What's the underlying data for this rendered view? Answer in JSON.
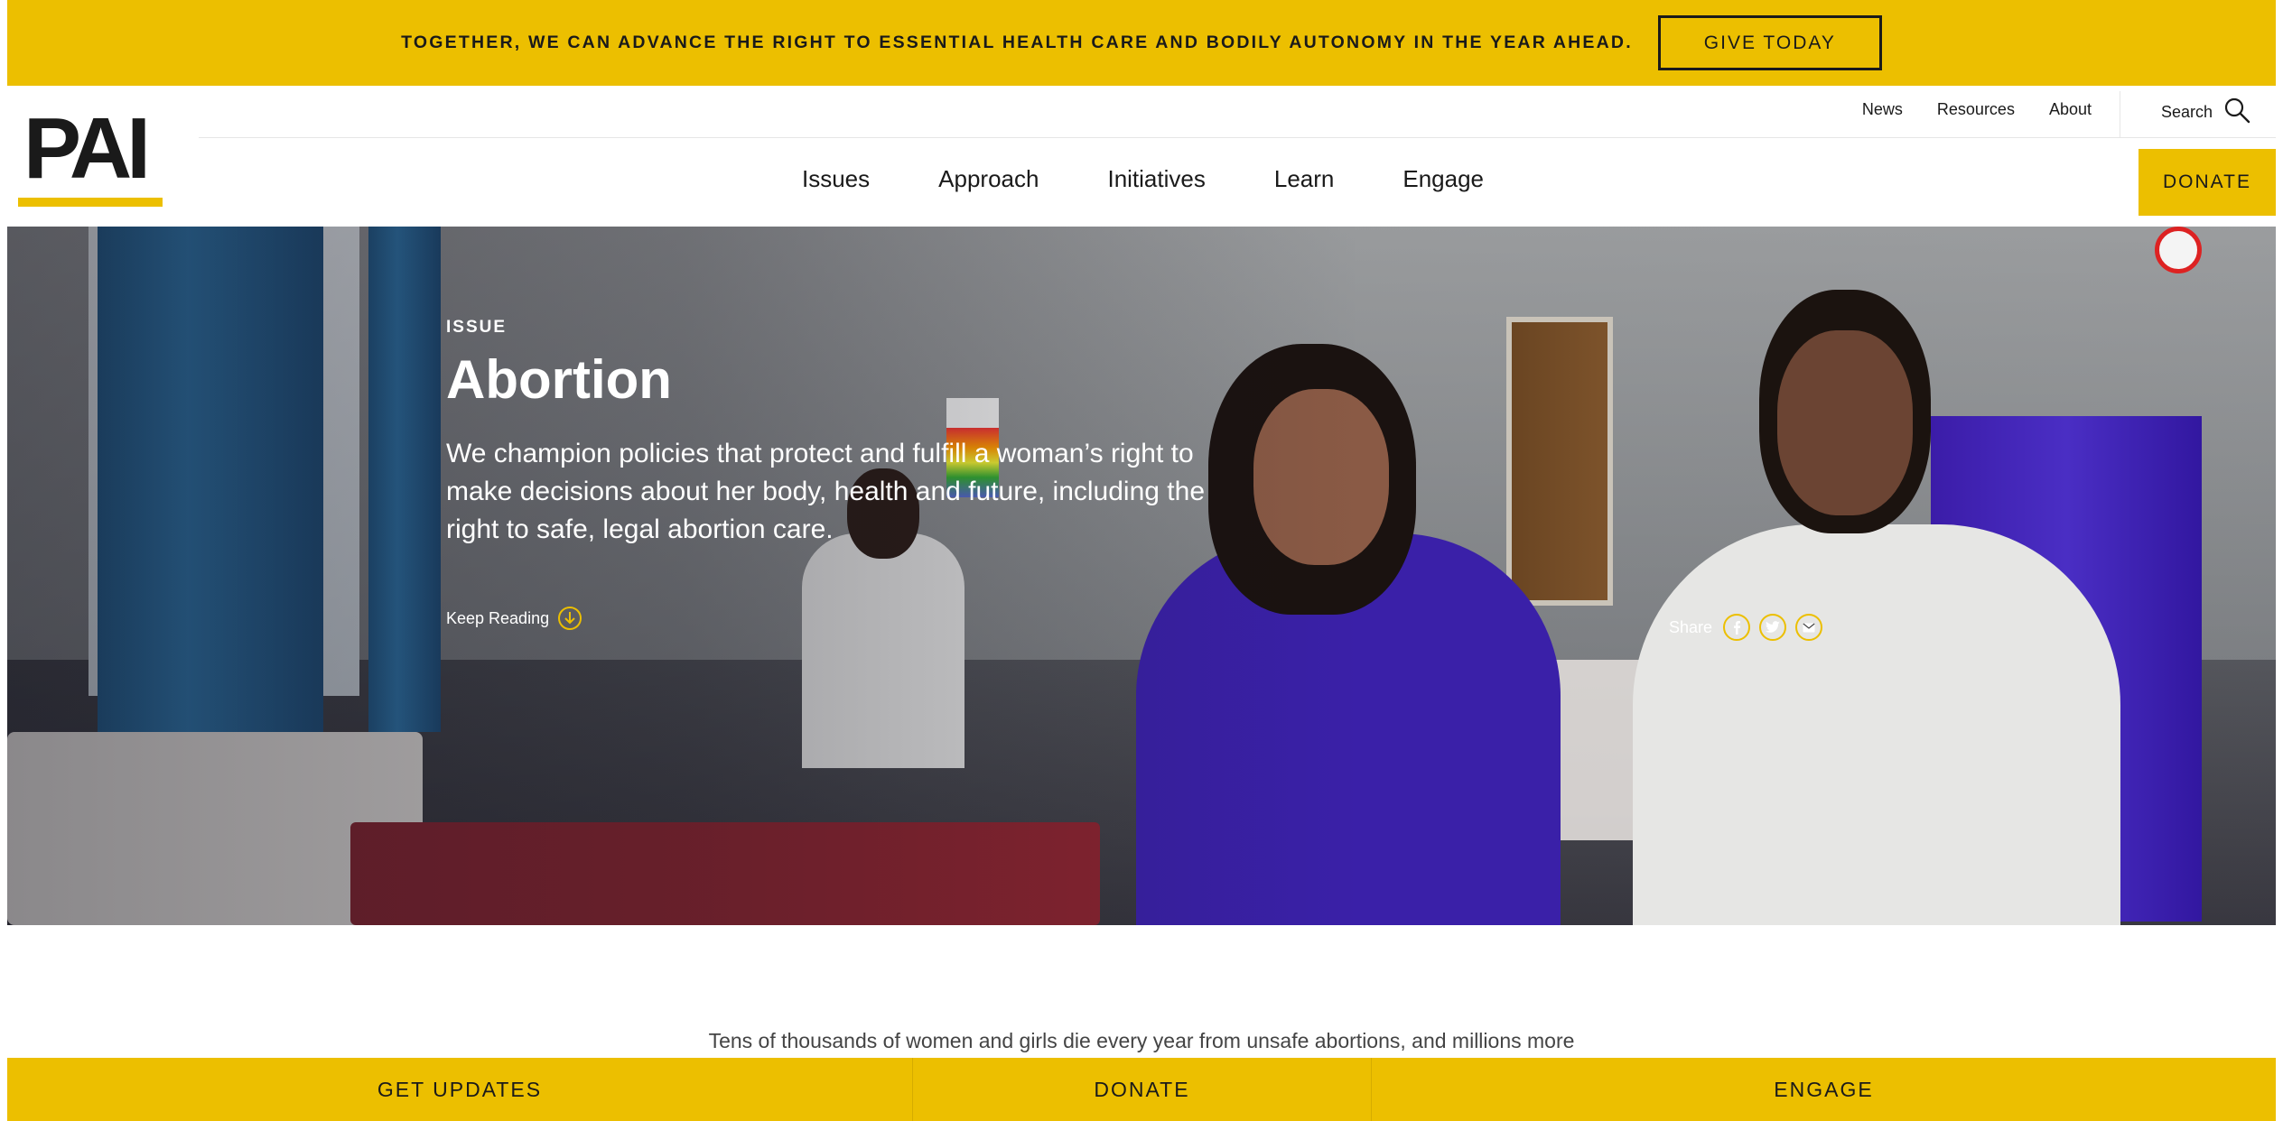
{
  "banner": {
    "message": "TOGETHER, WE CAN ADVANCE THE RIGHT TO ESSENTIAL HEALTH CARE AND BODILY AUTONOMY IN THE YEAR AHEAD.",
    "cta": "GIVE TODAY"
  },
  "header": {
    "logo_text": "PAI",
    "utility_links": [
      "News",
      "Resources",
      "About"
    ],
    "search_label": "Search",
    "nav": [
      "Issues",
      "Approach",
      "Initiatives",
      "Learn",
      "Engage"
    ],
    "donate": "DONATE"
  },
  "hero": {
    "eyebrow": "ISSUE",
    "title": "Abortion",
    "description": "We champion policies that protect and fulfill a woman’s right to make decisions about her body, health and future, including the right to safe, legal abortion care.",
    "keep_reading": "Keep Reading",
    "share_label": "Share",
    "share_icons": [
      "facebook-icon",
      "twitter-icon",
      "email-icon"
    ]
  },
  "intro_text": "Tens of thousands of women and girls die every year from unsafe abortions, and millions more",
  "bottom_bar": [
    "GET UPDATES",
    "DONATE",
    "ENGAGE"
  ],
  "colors": {
    "accent": "#ecbf00",
    "text": "#1a1a1a",
    "hero_text": "#ffffff"
  }
}
